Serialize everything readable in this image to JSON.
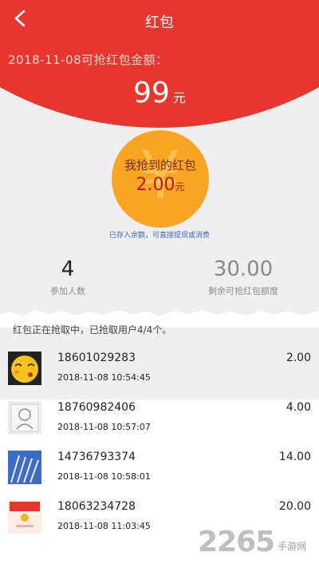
{
  "header": {
    "title": "红包",
    "back_icon": "chevron-left-icon"
  },
  "summary": {
    "date_line": "2018-11-08可抢红包金额：",
    "total_amount": "99",
    "total_unit": "元"
  },
  "coin": {
    "label": "我抢到的红包",
    "amount": "2.00",
    "unit": "元",
    "icon": "yen-icon"
  },
  "note": "已存入余额，可直接提现或消费",
  "stats": {
    "participants": {
      "value": "4",
      "label": "参加人数"
    },
    "remaining": {
      "value": "30.00",
      "label": "剩余可抢红包额度"
    }
  },
  "status_text": "红包正在抢取中，已抢取用户4/4个。",
  "records": [
    {
      "phone": "18601029283",
      "time": "2018-11-08 10:54:45",
      "amount": "2.00",
      "avatar": "emoji-kiss-avatar"
    },
    {
      "phone": "18760982406",
      "time": "2018-11-08 10:57:07",
      "amount": "4.00",
      "avatar": "person-sketch-avatar"
    },
    {
      "phone": "14736793374",
      "time": "2018-11-08 10:58:01",
      "amount": "14.00",
      "avatar": "jets-photo-avatar"
    },
    {
      "phone": "18063234728",
      "time": "2018-11-08 11:03:45",
      "amount": "20.00",
      "avatar": "red-envelope-avatar"
    }
  ],
  "watermark": {
    "number": "2265",
    "text": "手游网"
  },
  "colors": {
    "primary_red": "#e8362f",
    "coin_orange": "#f7a523",
    "note_blue": "#3a6ab8"
  }
}
